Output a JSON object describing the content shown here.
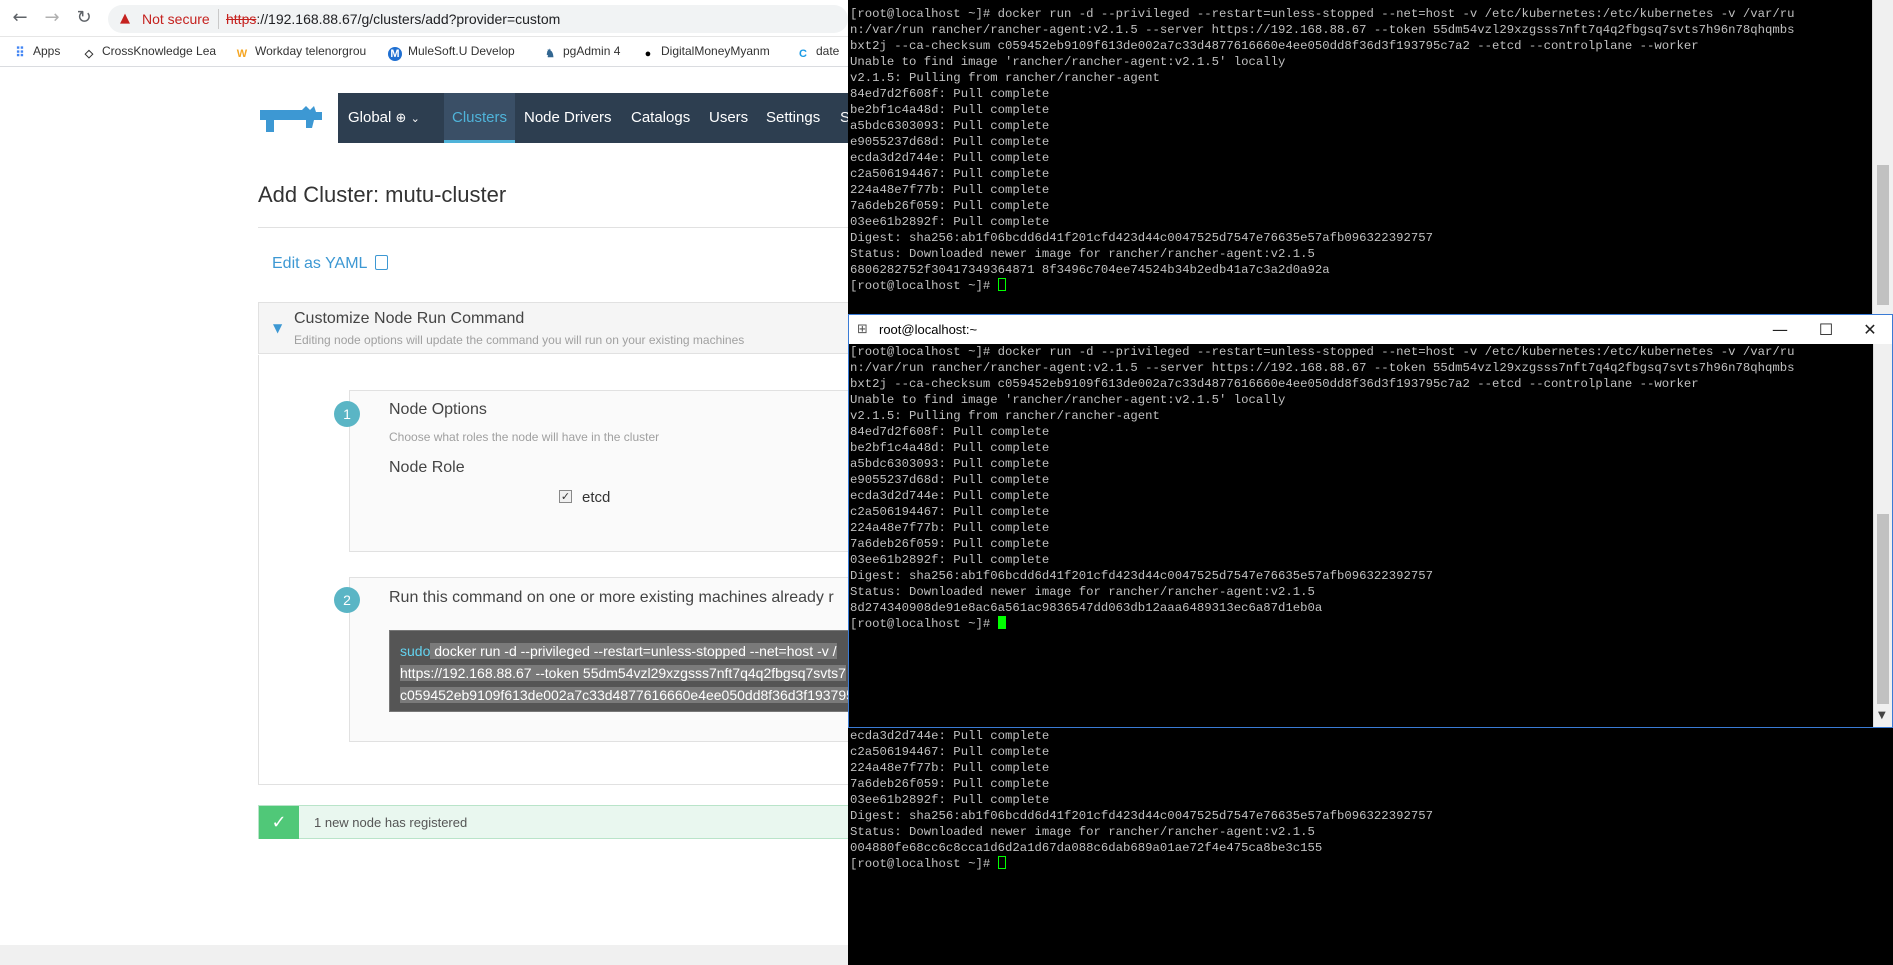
{
  "browser": {
    "not_secure": "Not secure",
    "url_scheme": "https",
    "url_rest": "://192.168.88.67/g/clusters/add?provider=custom",
    "bookmarks": [
      "Apps",
      "CrossKnowledge Lea",
      "Workday telenorgrou",
      "MuleSoft.U Develop",
      "pgAdmin 4",
      "DigitalMoneyMyanm",
      "date"
    ]
  },
  "nav": {
    "global": "Global",
    "items": [
      "Clusters",
      "Node Drivers",
      "Catalogs",
      "Users",
      "Settings",
      "S"
    ]
  },
  "page": {
    "title": "Add Cluster: mutu-cluster",
    "edit_yaml": "Edit as YAML",
    "panel_title": "Customize Node Run Command",
    "panel_subtitle": "Editing node options will update the command you will run on your existing machines",
    "step1_num": "1",
    "step1_title": "Node Options",
    "step1_sub": "Choose what roles the node will have in the cluster",
    "node_role": "Node Role",
    "etcd": "etcd",
    "step2_num": "2",
    "step2_title": "Run this command on one or more existing machines already r",
    "cmd_sudo": "sudo",
    "cmd_line1": " docker run -d --privileged --restart=unless-stopped --net=host -v /",
    "cmd_line2": "https://192.168.88.67 --token 55dm54vzl29xzgsss7nft7q4q2fbgsq7svts7",
    "cmd_line3": "c059452eb9109f613de002a7c33d4877616660e4ee050dd8f36d3f193795",
    "registered": "1 new node has registered"
  },
  "window": {
    "title": "root@localhost:~",
    "min": "—",
    "max": "☐",
    "close": "✕"
  },
  "terminal_top": {
    "lines": [
      "[root@localhost ~]# docker run -d --privileged --restart=unless-stopped --net=host -v /etc/kubernetes:/etc/kubernetes -v /var/ru",
      "n:/var/run rancher/rancher-agent:v2.1.5 --server https://192.168.88.67 --token 55dm54vzl29xzgsss7nft7q4q2fbgsq7svts7h96n78qhqmbs",
      "bxt2j --ca-checksum c059452eb9109f613de002a7c33d4877616660e4ee050dd8f36d3f193795c7a2 --etcd --controlplane --worker",
      "Unable to find image 'rancher/rancher-agent:v2.1.5' locally",
      "v2.1.5: Pulling from rancher/rancher-agent",
      "84ed7d2f608f: Pull complete",
      "be2bf1c4a48d: Pull complete",
      "a5bdc6303093: Pull complete",
      "e9055237d68d: Pull complete",
      "ecda3d2d744e: Pull complete",
      "c2a506194467: Pull complete",
      "224a48e7f77b: Pull complete",
      "7a6deb26f059: Pull complete",
      "03ee61b2892f: Pull complete",
      "Digest: sha256:ab1f06bcdd6d41f201cfd423d44c0047525d7547e76635e57afb096322392757",
      "Status: Downloaded newer image for rancher/rancher-agent:v2.1.5",
      "6806282752f30417349364871 8f3496c704ee74524b34b2edb41a7c3a2d0a92a",
      "[root@localhost ~]# "
    ]
  },
  "terminal_mid": {
    "lines": [
      "[root@localhost ~]# docker run -d --privileged --restart=unless-stopped --net=host -v /etc/kubernetes:/etc/kubernetes -v /var/ru",
      "n:/var/run rancher/rancher-agent:v2.1.5 --server https://192.168.88.67 --token 55dm54vzl29xzgsss7nft7q4q2fbgsq7svts7h96n78qhqmbs",
      "bxt2j --ca-checksum c059452eb9109f613de002a7c33d4877616660e4ee050dd8f36d3f193795c7a2 --etcd --controlplane --worker",
      "Unable to find image 'rancher/rancher-agent:v2.1.5' locally",
      "v2.1.5: Pulling from rancher/rancher-agent",
      "84ed7d2f608f: Pull complete",
      "be2bf1c4a48d: Pull complete",
      "a5bdc6303093: Pull complete",
      "e9055237d68d: Pull complete",
      "ecda3d2d744e: Pull complete",
      "c2a506194467: Pull complete",
      "224a48e7f77b: Pull complete",
      "7a6deb26f059: Pull complete",
      "03ee61b2892f: Pull complete",
      "Digest: sha256:ab1f06bcdd6d41f201cfd423d44c0047525d7547e76635e57afb096322392757",
      "Status: Downloaded newer image for rancher/rancher-agent:v2.1.5",
      "8d274340908de91e8ac6a561ac9836547dd063db12aaa6489313ec6a87d1eb0a",
      "[root@localhost ~]# "
    ]
  },
  "terminal_bottom": {
    "lines": [
      "ecda3d2d744e: Pull complete",
      "c2a506194467: Pull complete",
      "224a48e7f77b: Pull complete",
      "7a6deb26f059: Pull complete",
      "03ee61b2892f: Pull complete",
      "Digest: sha256:ab1f06bcdd6d41f201cfd423d44c0047525d7547e76635e57afb096322392757",
      "Status: Downloaded newer image for rancher/rancher-agent:v2.1.5",
      "004880fe68cc6c8cca1d6d2a1d67da088c6dab689a01ae72f4e475ca8be3c155",
      "[root@localhost ~]# "
    ]
  }
}
